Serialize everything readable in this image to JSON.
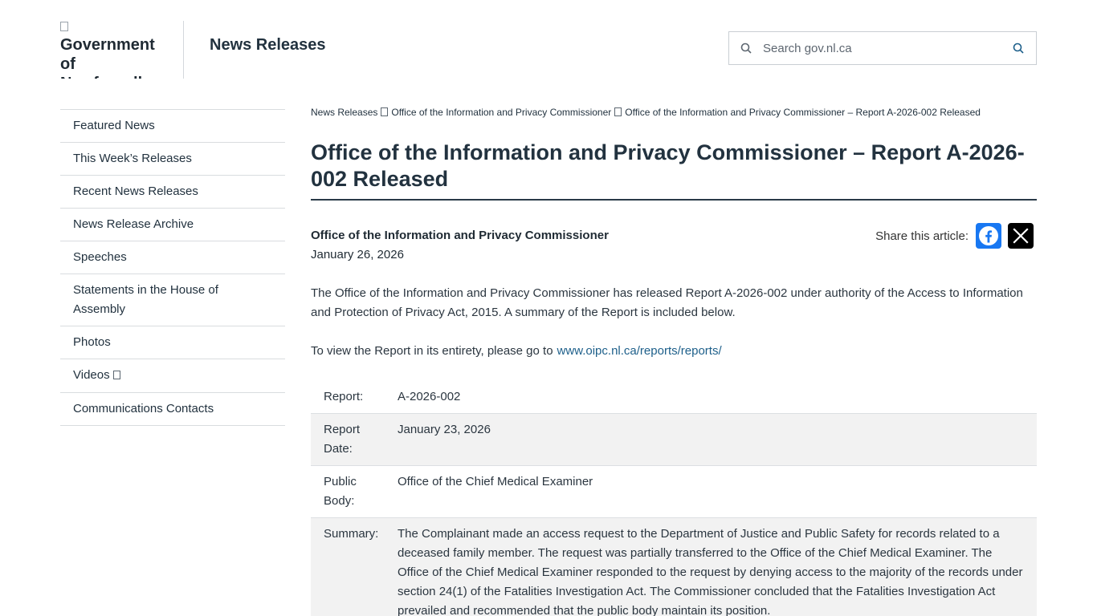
{
  "header": {
    "logo_alt": "Government of Newfoundland and Labrador",
    "site_title": "News Releases",
    "search_placeholder": "Search gov.nl.ca"
  },
  "sidebar": {
    "items": [
      {
        "label": "Featured News"
      },
      {
        "label": "This Week’s Releases"
      },
      {
        "label": "Recent News Releases"
      },
      {
        "label": "News Release Archive"
      },
      {
        "label": "Speeches"
      },
      {
        "label": "Statements in the House of Assembly"
      },
      {
        "label": "Photos"
      },
      {
        "label": "Videos",
        "external": true
      },
      {
        "label": "Communications Contacts"
      }
    ]
  },
  "breadcrumb": [
    "News Releases",
    "Office of the Information and Privacy Commissioner",
    "Office of the Information and Privacy Commissioner – Report A-2026-002 Released"
  ],
  "article": {
    "title": "Office of the Information and Privacy Commissioner – Report A-2026-002 Released",
    "organization": "Office of the Information and Privacy Commissioner",
    "date": "January 26, 2026",
    "share_label": "Share this article:",
    "intro": "The Office of the Information and Privacy Commissioner has released Report A-2026-002 under authority of the Access to Information and Protection of Privacy Act, 2015. A summary of the Report is included below.",
    "view_text": "To view the Report in its entirety, please go to",
    "view_link": "www.oipc.nl.ca/reports/reports/",
    "table": [
      {
        "key": "Report:",
        "value": "A-2026-002"
      },
      {
        "key": "Report Date:",
        "value": "January 23, 2026"
      },
      {
        "key": "Public Body:",
        "value": "Office of the Chief Medical Examiner"
      },
      {
        "key": "Summary:",
        "value": "The Complainant made an access request to the Department of Justice and Public Safety for records related to a deceased family member. The request was partially transferred to the Office of the Chief Medical Examiner. The Office of the Chief Medical Examiner responded to the request by denying access to the majority of the records under section 24(1) of the Fatalities Investigation Act. The Commissioner concluded that the Fatalities Investigation Act prevailed and recommended that the public body maintain its position."
      }
    ]
  },
  "icons": {
    "search": "search-icon",
    "facebook": "facebook-icon",
    "x": "x-icon",
    "external": "external-link-icon"
  },
  "colors": {
    "heading": "#22323f",
    "link": "#1d5f8a",
    "facebook": "#1877f2",
    "x": "#000000",
    "table_alt_row": "#f2f2f2"
  }
}
